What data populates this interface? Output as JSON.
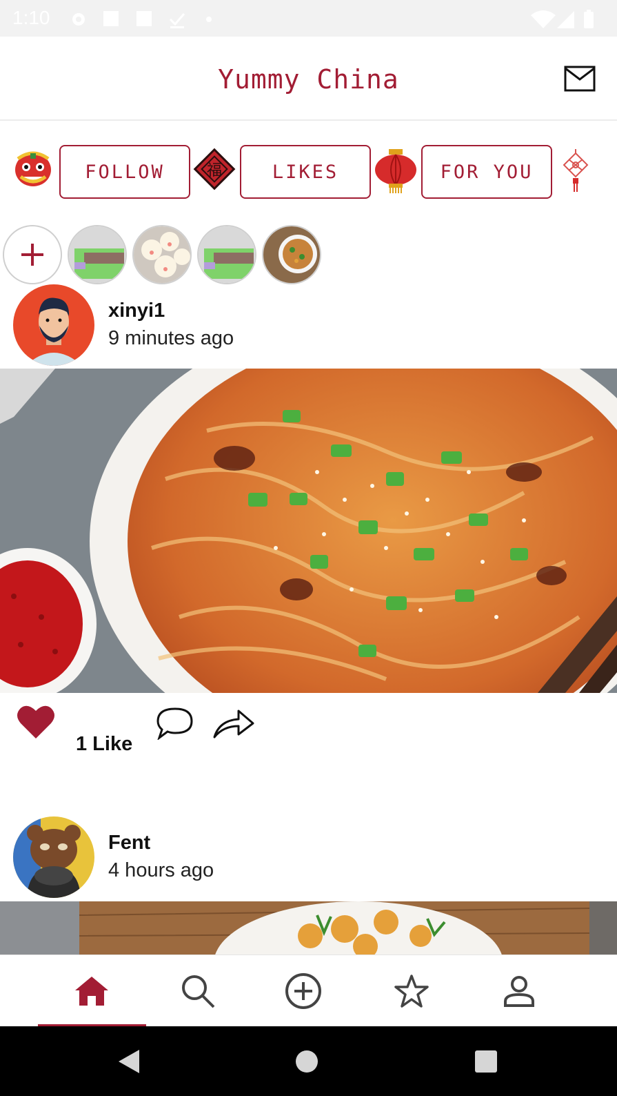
{
  "status_bar": {
    "time": "1:10"
  },
  "app_bar": {
    "title": "Yummy China",
    "mail_icon": "mail-icon"
  },
  "categories": [
    {
      "label": "FOLLOW",
      "deco": "lion-dance-icon"
    },
    {
      "label": "LIKES",
      "deco": "fu-diamond-icon"
    },
    {
      "label": "FOR YOU",
      "deco": "lantern-icon"
    }
  ],
  "stories": {
    "add_icon": "plus-icon",
    "count": 4
  },
  "posts": [
    {
      "user": "xinyi1",
      "time": "9 minutes ago",
      "likes": "1 Like",
      "liked": true
    },
    {
      "user": "Fent",
      "time": "4 hours ago"
    }
  ],
  "bottom_nav": {
    "items": [
      "home-icon",
      "search-icon",
      "add-circle-icon",
      "star-icon",
      "profile-icon"
    ],
    "active": "home-icon"
  },
  "colors": {
    "accent": "#a21d34",
    "status_bar": "#f2f2f2",
    "nav_bar": "#000000"
  }
}
